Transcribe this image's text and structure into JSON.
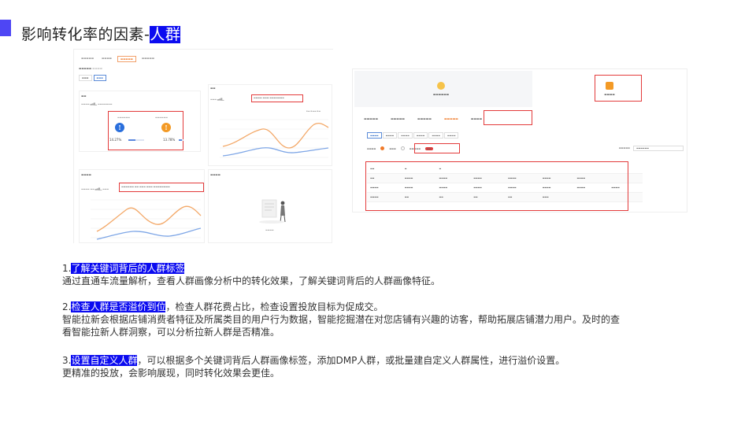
{
  "header": {
    "title_prefix": "影响转化率的因素-",
    "title_highlight": "人群"
  },
  "points": [
    {
      "num": "1.",
      "heading": "了解关键词背后的人群标签",
      "heading_rest": "",
      "lines": [
        "通过直通车流量解析，查看人群画像分析中的转化效果，了解关键词背后的人群画像特征。"
      ]
    },
    {
      "num": "2.",
      "heading": "检查人群是否溢价到位",
      "heading_rest": "，检查人群花费占比，检查设置投放目标为促成交。",
      "lines": [
        "智能拉新会根据店铺消费者特征及所属类目的用户行为数据，智能挖掘潜在对您店铺有兴趣的访客，帮助拓展店铺潜力用户。及时的查",
        "看智能拉新人群洞察，可以分析拉新人群是否精准。"
      ]
    },
    {
      "num": "3.",
      "heading": "设置自定义人群",
      "heading_rest": "，可以根据多个关键词背后人群画像标签，添加DMP人群，或批量建自定义人群属性，进行溢价设置。",
      "lines": [
        "更精准的投放，会影响展现，同时转化效果会更佳。"
      ]
    }
  ],
  "screenshot1": {
    "pct_a": "14.27%",
    "pct_b": "13.78%"
  },
  "colors": {
    "accent": "#4e46f4",
    "highlight": "#0b0bf0",
    "frame_red": "#e33b3b",
    "orange": "#f39a26",
    "blue": "#2a6fdc"
  }
}
